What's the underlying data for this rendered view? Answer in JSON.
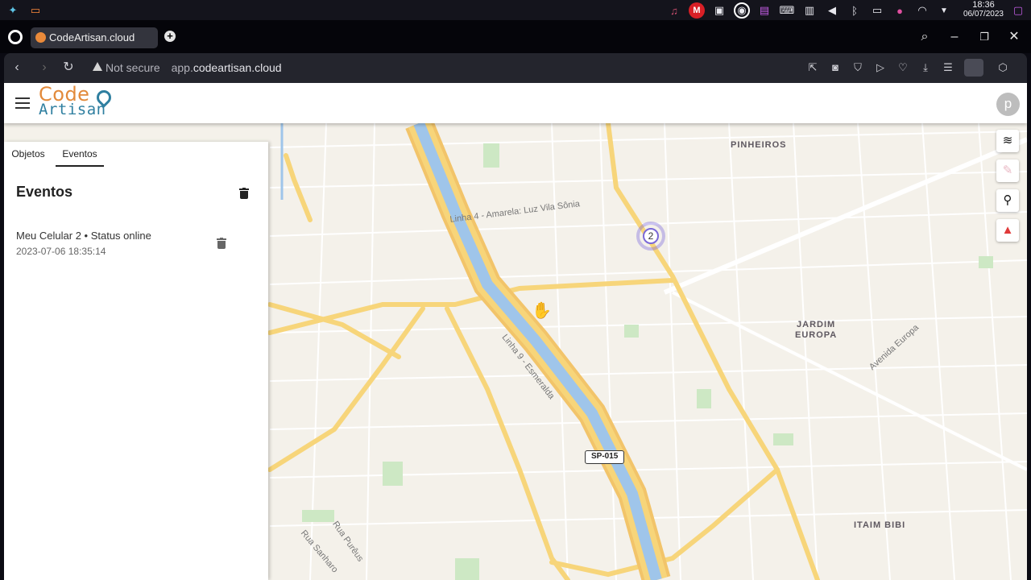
{
  "taskbar": {
    "time": "18:36",
    "date": "06/07/2023",
    "icons": [
      "app-launcher-icon",
      "folder-icon",
      "notification-bell-icon",
      "mega-icon",
      "chat-icon",
      "obs-icon",
      "shopping-icon",
      "terminal-icon",
      "notes-icon",
      "volume-icon",
      "bluetooth-icon",
      "display-icon",
      "microphone-icon",
      "wifi-icon",
      "tray-arrow-icon",
      "power-icon"
    ]
  },
  "browser": {
    "tab_title": "CodeArtisan.cloud",
    "new_tab": "+",
    "security_label": "Not secure",
    "url_prefix": "app.",
    "url_domain": "codeartisan.cloud"
  },
  "app": {
    "logo_line1": "Code",
    "logo_line2": "Artisan",
    "user_initial": "p"
  },
  "panel": {
    "tabs": [
      {
        "label": "Objetos"
      },
      {
        "label": "Eventos"
      }
    ],
    "active_tab": "Eventos",
    "title": "Eventos",
    "events": [
      {
        "title": "Meu Celular 2 • Status online",
        "time": "2023-07-06 18:35:14"
      }
    ]
  },
  "map": {
    "labels": {
      "pinheiros": "PINHEIROS",
      "jardim_europa_1": "JARDIM",
      "jardim_europa_2": "EUROPA",
      "itaim_bibi": "ITAIM BIBI"
    },
    "roads": {
      "linha4": "Linha 4 - Amarela: Luz  Vila Sônia",
      "linha9": "Linha 9 - Esmeralda",
      "avenida_europa": "Avenida Europa",
      "rua_pureus": "Rua Purêus",
      "rua_sanharo": "Rua Sanharo"
    },
    "shield": "SP-015",
    "cluster_count": "2",
    "controls": [
      "layers-icon",
      "edit-disabled-icon",
      "search-icon",
      "alarm-icon"
    ]
  }
}
